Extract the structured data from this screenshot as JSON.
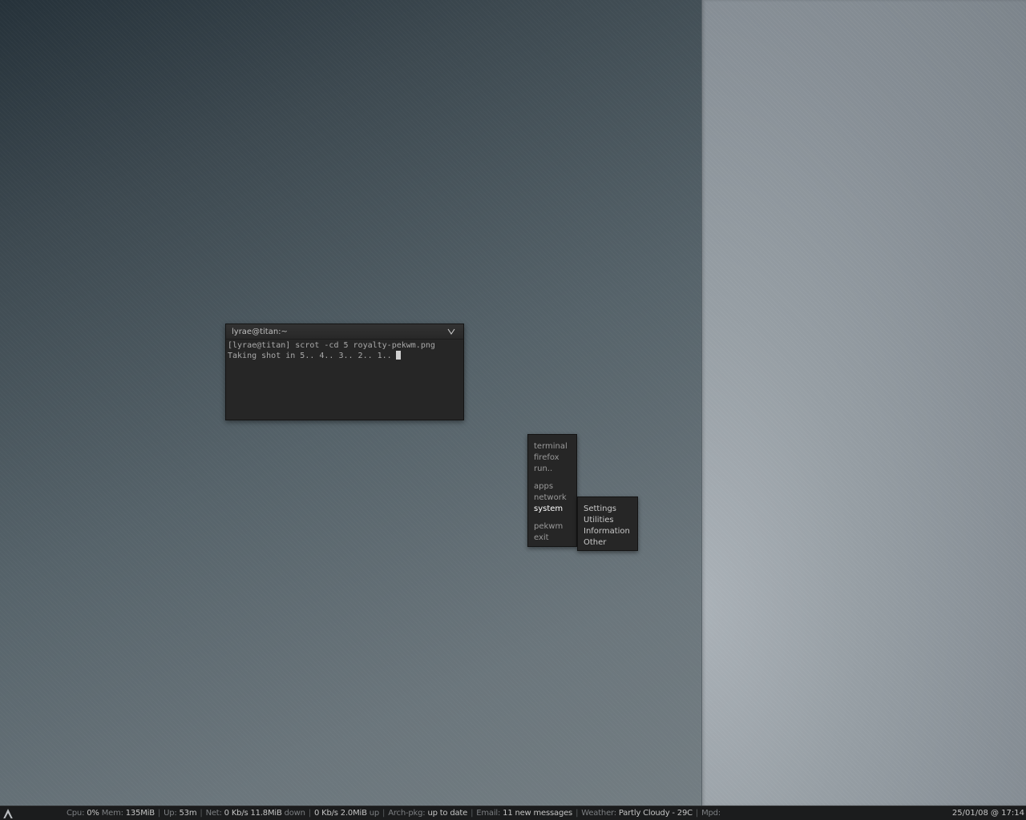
{
  "terminal": {
    "title": "lyrae@titan:~",
    "lines": [
      "[lyrae@titan] scrot -cd 5 royalty-pekwm.png",
      "Taking shot in 5.. 4.. 3.. 2.. 1.."
    ]
  },
  "root_menu": {
    "items": [
      "terminal",
      "firefox",
      "run..",
      "apps",
      "network",
      "system",
      "pekwm",
      "exit"
    ],
    "active": "system"
  },
  "system_submenu": {
    "items": [
      "Settings",
      "Utilities",
      "Information",
      "Other"
    ]
  },
  "statusbar": {
    "cpu_label": "Cpu:",
    "cpu": "0%",
    "mem_label": "Mem:",
    "mem": "135MiB",
    "up_label": "Up:",
    "up": "53m",
    "net_label": "Net:",
    "net_down_rate": "0 Kb/s",
    "net_down_total": "11.8MiB",
    "down_label": "down",
    "net_up_rate": "0 Kb/s",
    "net_up_total": "2.0MiB",
    "up_dir_label": "up",
    "archpkg_label": "Arch-pkg:",
    "archpkg": "up to date",
    "email_label": "Email:",
    "email": "11 new messages",
    "weather_label": "Weather:",
    "weather": "Partly Cloudy - 29C",
    "mpd_label": "Mpd:",
    "datetime": "25/01/08 @ 17:14"
  },
  "icons": {
    "launcher": "arch-logo-icon",
    "terminal_button": "chevron-down-icon"
  },
  "colors": {
    "window_bg": "#262626",
    "menu_text": "#9a9a9a",
    "menu_active": "#ffffff",
    "statusbar_bg": "#1b1c1d"
  }
}
